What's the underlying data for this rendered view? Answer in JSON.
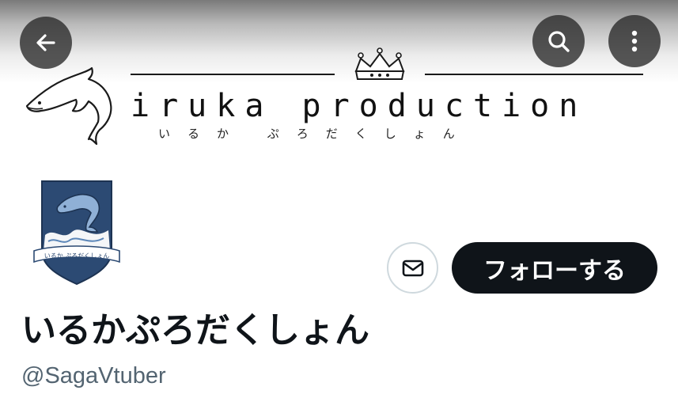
{
  "header": {
    "back_icon": "arrow-left-icon",
    "search_icon": "search-icon",
    "more_icon": "more-vertical-icon"
  },
  "banner": {
    "title": "iruka production",
    "kana": "いるか ぷろだくしょん",
    "illustrations": [
      "dolphin",
      "crown"
    ]
  },
  "avatar": {
    "crest_text": "いるか ぷろだくしょん",
    "illustration": "dolphin-crest"
  },
  "actions": {
    "message_icon": "mail-icon",
    "follow_label": "フォローする"
  },
  "profile": {
    "display_name": "いるかぷろだくしょん",
    "handle": "@SagaVtuber"
  },
  "colors": {
    "follow_bg": "#0f1419",
    "follow_text": "#ffffff",
    "handle_text": "#536471",
    "icon_button_bg": "#3a3a3a"
  }
}
